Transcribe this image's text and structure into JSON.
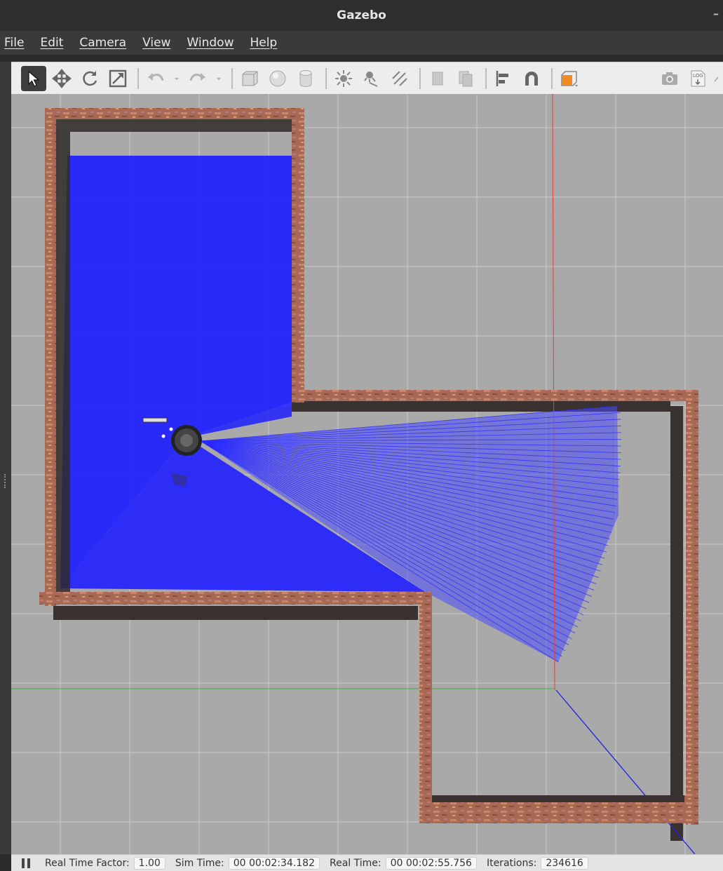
{
  "window": {
    "title": "Gazebo",
    "minimize_glyph": "–"
  },
  "menu": [
    {
      "label": "File"
    },
    {
      "label": "Edit"
    },
    {
      "label": "Camera"
    },
    {
      "label": "View"
    },
    {
      "label": "Window"
    },
    {
      "label": "Help"
    }
  ],
  "toolbar": {
    "items": [
      {
        "icon": "select-arrow-icon",
        "active": true
      },
      {
        "icon": "translate-icon"
      },
      {
        "icon": "rotate-icon"
      },
      {
        "icon": "scale-icon"
      },
      {
        "icon": "undo-icon"
      },
      {
        "icon": "redo-icon"
      },
      {
        "icon": "box-icon"
      },
      {
        "icon": "sphere-icon"
      },
      {
        "icon": "cylinder-icon"
      },
      {
        "icon": "point-light-icon"
      },
      {
        "icon": "spot-light-icon"
      },
      {
        "icon": "directional-light-icon"
      },
      {
        "icon": "copy-icon"
      },
      {
        "icon": "paste-icon"
      },
      {
        "icon": "align-icon"
      },
      {
        "icon": "snap-icon"
      },
      {
        "icon": "view-angle-icon"
      },
      {
        "icon": "screenshot-icon"
      },
      {
        "icon": "log-icon"
      }
    ],
    "log_label": "LOG",
    "colors": {
      "accent_orange": "#f08a24"
    }
  },
  "status": {
    "real_time_factor_label": "Real Time Factor:",
    "real_time_factor": "1.00",
    "sim_time_label": "Sim Time:",
    "sim_time": "00 00:02:34.182",
    "real_time_label": "Real Time:",
    "real_time": "00 00:02:55.756",
    "iterations_label": "Iterations:",
    "iterations": "234616"
  },
  "scene": {
    "colors": {
      "ground": "#a9a9a9",
      "grid_line": "#c4c4c4",
      "wall_brick": "#a86a55",
      "wall_shadow": "#3a3230",
      "laser": "#1f1fff",
      "axis_x": "#e04040",
      "axis_y": "#40b040",
      "axis_z": "#2020e0",
      "robot": "#2b2b2b"
    }
  }
}
